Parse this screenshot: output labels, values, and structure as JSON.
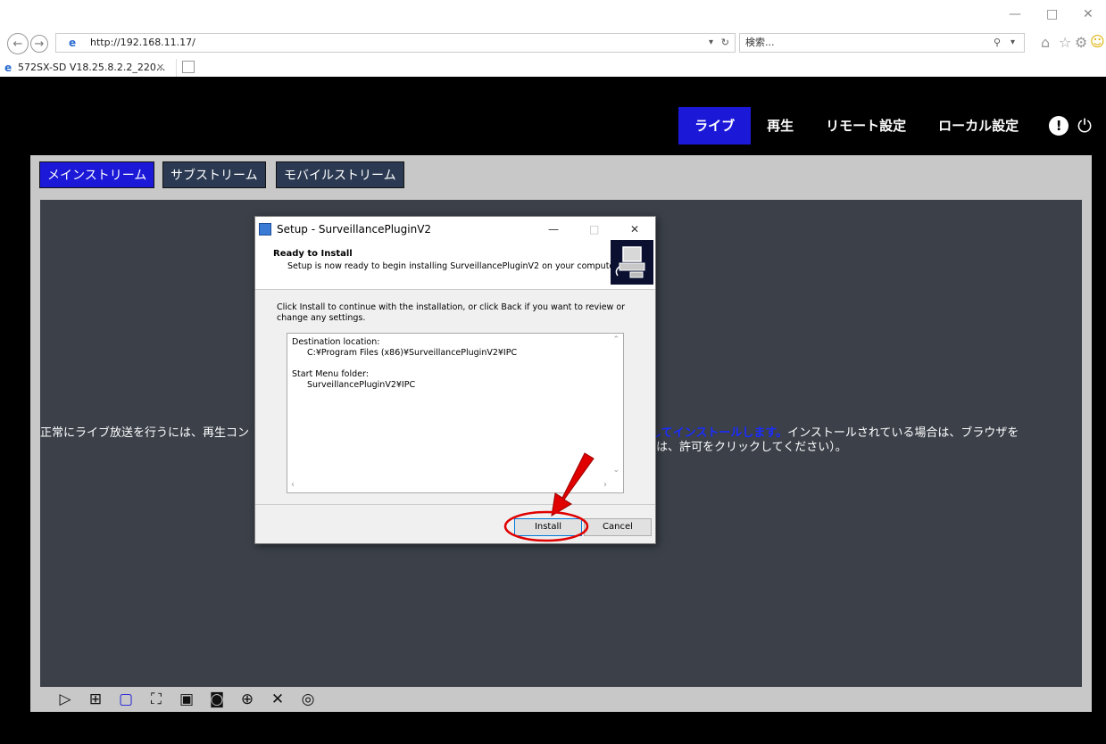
{
  "browser": {
    "url": "http://192.168.11.17/",
    "search_placeholder": "検索...",
    "tab_title": "572SX-SD V18.25.8.2.2_220...",
    "win_min": "—",
    "win_max": "□",
    "win_close": "✕"
  },
  "nav": {
    "live": "ライブ",
    "playback": "再生",
    "remote_settings": "リモート設定",
    "local_settings": "ローカル設定"
  },
  "streams": {
    "main": "メインストリーム",
    "sub": "サブストリーム",
    "mobile": "モバイルストリーム"
  },
  "message": {
    "part1": "正常にライブ放送を行うには、再生コン",
    "link": "ロードしてインストールします。",
    "part2": "インストールされている場合は、ブラウザを",
    "line2": "は、許可をクリックしてください）。"
  },
  "dialog": {
    "title": "Setup - SurveillancePluginV2",
    "heading": "Ready to Install",
    "subheading": "Setup is now ready to begin installing SurveillancePluginV2 on your computer.",
    "description": "Click Install to continue with the installation, or click Back if you want to review or change any settings.",
    "dest_label": "Destination location:",
    "dest_value": "C:¥Program Files (x86)¥SurveillancePluginV2¥IPC",
    "menu_label": "Start Menu folder:",
    "menu_value": "SurveillancePluginV2¥IPC",
    "install": "Install",
    "cancel": "Cancel"
  },
  "colors": {
    "active_nav": "#1b18d8",
    "annotation": "#e00000"
  }
}
